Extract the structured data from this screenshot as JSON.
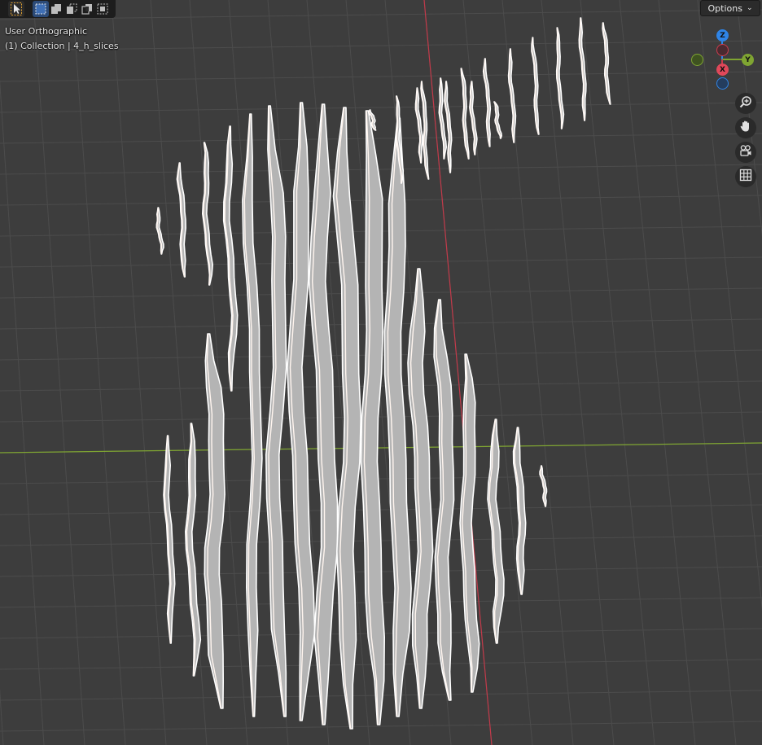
{
  "viewport": {
    "view_name": "User Orthographic",
    "collection_info": "(1) Collection | 4_h_slices"
  },
  "header": {
    "tools": [
      {
        "name": "select-tool",
        "icon": "cursor-icon",
        "active": true
      },
      {
        "name": "mode-set-new",
        "icon": "select-new-icon",
        "active": true
      },
      {
        "name": "mode-extend",
        "icon": "select-extend-icon",
        "active": false
      },
      {
        "name": "mode-subtract",
        "icon": "select-subtract-icon",
        "active": false
      },
      {
        "name": "mode-invert",
        "icon": "select-invert-icon",
        "active": false
      },
      {
        "name": "mode-intersect",
        "icon": "select-intersect-icon",
        "active": false
      }
    ],
    "options_label": "Options"
  },
  "gizmo": {
    "z_label": "Z",
    "y_label": "Y",
    "x_label": "X"
  },
  "nav_buttons": [
    {
      "name": "zoom",
      "icon": "zoom-icon"
    },
    {
      "name": "pan",
      "icon": "hand-icon"
    },
    {
      "name": "camera",
      "icon": "camera-icon"
    },
    {
      "name": "ortho-toggle",
      "icon": "grid-icon"
    }
  ],
  "colors": {
    "background": "#3d3d3d",
    "grid": "#4c4c4c",
    "x_axis": "#cc3b4d",
    "y_axis": "#7fa532",
    "z_axis": "#2f84e6",
    "slice_fill": "#b4b4b4",
    "slice_edge": "#ffffff",
    "slice_highlight": "#fff5ef"
  }
}
